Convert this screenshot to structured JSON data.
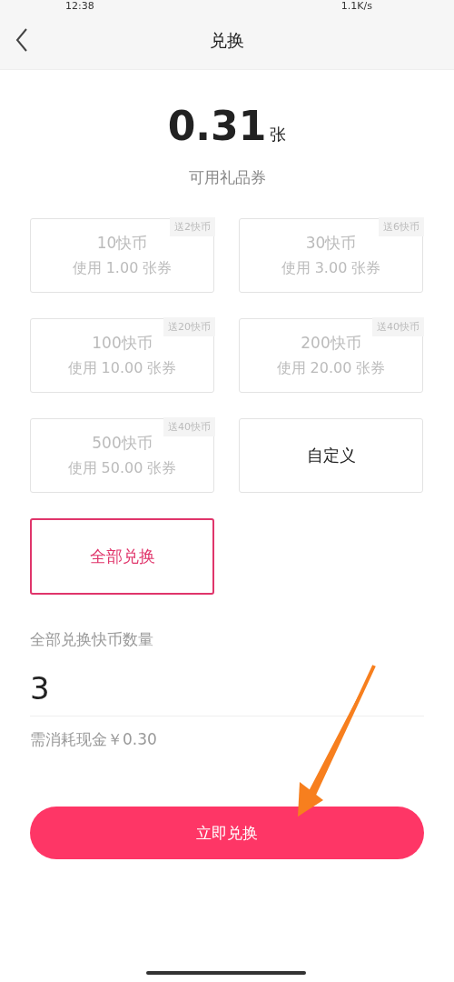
{
  "status_bar": {
    "time": "12:38",
    "speed": "1.1K/s"
  },
  "nav": {
    "title": "兑换"
  },
  "balance": {
    "amount": "0.31",
    "unit": "张",
    "label": "可用礼品券"
  },
  "options": [
    {
      "kind": "package",
      "coins": "10快币",
      "cost": "使用 1.00 张券",
      "bonus": "送2快币",
      "disabled": true,
      "selected": false
    },
    {
      "kind": "package",
      "coins": "30快币",
      "cost": "使用 3.00 张券",
      "bonus": "送6快币",
      "disabled": true,
      "selected": false
    },
    {
      "kind": "package",
      "coins": "100快币",
      "cost": "使用 10.00 张券",
      "bonus": "送20快币",
      "disabled": true,
      "selected": false
    },
    {
      "kind": "package",
      "coins": "200快币",
      "cost": "使用 20.00 张券",
      "bonus": "送40快币",
      "disabled": true,
      "selected": false
    },
    {
      "kind": "package",
      "coins": "500快币",
      "cost": "使用 50.00 张券",
      "bonus": "送40快币",
      "disabled": true,
      "selected": false
    },
    {
      "kind": "custom",
      "label": "自定义",
      "disabled": false,
      "selected": false
    },
    {
      "kind": "custom",
      "label": "全部兑换",
      "disabled": false,
      "selected": true
    }
  ],
  "amount_field": {
    "label": "全部兑换快币数量",
    "value": "3"
  },
  "cost_note": "需消耗现金￥0.30",
  "submit_button": "立即兑换"
}
